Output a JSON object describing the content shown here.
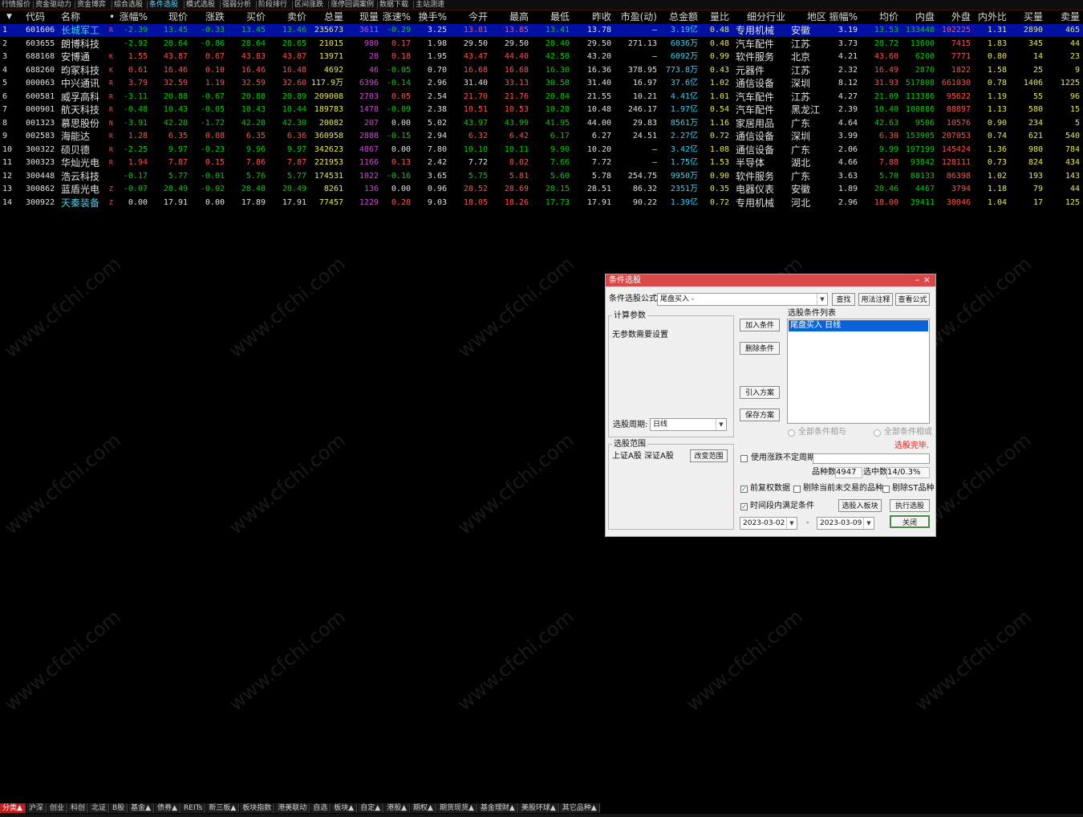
{
  "top_tabs": [
    "行情报价",
    "资金驱动力",
    "资金博弈",
    "综合选股",
    "条件选股",
    "模式选股",
    "强弱分析",
    "阶段排行",
    "区间涨跌",
    "涨停回调案例",
    "数据下载",
    "主站测速"
  ],
  "active_top_tab": "条件选股",
  "columns": [
    "",
    "代码",
    "名称",
    "•",
    "涨幅%",
    "现价",
    "涨跌",
    "买价",
    "卖价",
    "总量",
    "现量",
    "涨速%",
    "换手%",
    "今开",
    "最高",
    "最低",
    "昨收",
    "市盈(动)",
    "总金额",
    "量比",
    "细分行业",
    "地区",
    "振幅%",
    "均价",
    "内盘",
    "外盘",
    "内外比",
    "买量",
    "卖量"
  ],
  "rows": [
    {
      "i": "1",
      "code": "601606",
      "name": "长城军工",
      "flag": "R",
      "chg": "-2.39",
      "price": "13.45",
      "diff": "-0.33",
      "bid": "13.45",
      "ask": "13.46",
      "vol": "235673",
      "cur": "3611",
      "speed": "-0.29",
      "turn": "3.25",
      "open": "13.81",
      "high": "13.85",
      "low": "13.41",
      "prev": "13.78",
      "pe": "–",
      "amt": "3.19亿",
      "vr": "0.48",
      "ind": "专用机械",
      "reg": "安徽",
      "amp": "3.19",
      "avg": "13.53",
      "inner": "133448",
      "outer": "102225",
      "io": "1.31",
      "bv": "2890",
      "sv": "465"
    },
    {
      "i": "2",
      "code": "603655",
      "name": "朗博科技",
      "flag": "",
      "chg": "-2.92",
      "price": "28.64",
      "diff": "-0.86",
      "bid": "28.64",
      "ask": "28.65",
      "vol": "21015",
      "cur": "980",
      "speed": "0.17",
      "turn": "1.98",
      "open": "29.50",
      "high": "29.50",
      "low": "28.40",
      "prev": "29.50",
      "pe": "271.13",
      "amt": "6036万",
      "vr": "0.48",
      "ind": "汽车配件",
      "reg": "江苏",
      "amp": "3.73",
      "avg": "28.72",
      "inner": "13600",
      "outer": "7415",
      "io": "1.83",
      "bv": "345",
      "sv": "44"
    },
    {
      "i": "3",
      "code": "688168",
      "name": "安博通",
      "flag": "K",
      "chg": "1.55",
      "price": "43.87",
      "diff": "0.67",
      "bid": "43.83",
      "ask": "43.87",
      "vol": "13971",
      "cur": "28",
      "speed": "0.18",
      "turn": "1.95",
      "open": "43.47",
      "high": "44.40",
      "low": "42.58",
      "prev": "43.20",
      "pe": "–",
      "amt": "6092万",
      "vr": "0.99",
      "ind": "软件服务",
      "reg": "北京",
      "amp": "4.21",
      "avg": "43.60",
      "inner": "6200",
      "outer": "7771",
      "io": "0.80",
      "bv": "14",
      "sv": "23"
    },
    {
      "i": "4",
      "code": "688260",
      "name": "昀冢科技",
      "flag": "K",
      "chg": "0.61",
      "price": "16.46",
      "diff": "0.10",
      "bid": "16.46",
      "ask": "16.48",
      "vol": "4692",
      "cur": "46",
      "speed": "-0.05",
      "turn": "0.70",
      "open": "16.68",
      "high": "16.68",
      "low": "16.30",
      "prev": "16.36",
      "pe": "378.95",
      "amt": "773.8万",
      "vr": "0.43",
      "ind": "元器件",
      "reg": "江苏",
      "amp": "2.32",
      "avg": "16.49",
      "inner": "2870",
      "outer": "1822",
      "io": "1.58",
      "bv": "25",
      "sv": "9"
    },
    {
      "i": "5",
      "code": "000063",
      "name": "中兴通讯",
      "flag": "R",
      "chg": "3.79",
      "price": "32.59",
      "diff": "1.19",
      "bid": "32.59",
      "ask": "32.60",
      "vol": "117.9万",
      "cur": "6396",
      "speed": "-0.14",
      "turn": "2.96",
      "open": "31.40",
      "high": "33.13",
      "low": "30.58",
      "prev": "31.40",
      "pe": "16.97",
      "amt": "37.6亿",
      "vr": "1.02",
      "ind": "通信设备",
      "reg": "深圳",
      "amp": "8.12",
      "avg": "31.93",
      "inner": "517808",
      "outer": "661030",
      "io": "0.78",
      "bv": "1406",
      "sv": "1225"
    },
    {
      "i": "6",
      "code": "600581",
      "name": "威孚高科",
      "flag": "R",
      "chg": "-3.11",
      "price": "20.88",
      "diff": "-0.67",
      "bid": "20.88",
      "ask": "20.89",
      "vol": "209008",
      "cur": "2703",
      "speed": "0.05",
      "turn": "2.54",
      "open": "21.70",
      "high": "21.76",
      "low": "20.84",
      "prev": "21.55",
      "pe": "10.21",
      "amt": "4.41亿",
      "vr": "1.01",
      "ind": "汽车配件",
      "reg": "江苏",
      "amp": "4.27",
      "avg": "21.09",
      "inner": "113386",
      "outer": "95622",
      "io": "1.19",
      "bv": "55",
      "sv": "96"
    },
    {
      "i": "7",
      "code": "000901",
      "name": "航天科技",
      "flag": "R",
      "chg": "-0.48",
      "price": "10.43",
      "diff": "-0.05",
      "bid": "10.43",
      "ask": "10.44",
      "vol": "189783",
      "cur": "1478",
      "speed": "-0.09",
      "turn": "2.38",
      "open": "10.51",
      "high": "10.53",
      "low": "10.28",
      "prev": "10.48",
      "pe": "246.17",
      "amt": "1.97亿",
      "vr": "0.54",
      "ind": "汽车配件",
      "reg": "黑龙江",
      "amp": "2.39",
      "avg": "10.40",
      "inner": "100886",
      "outer": "88897",
      "io": "1.13",
      "bv": "580",
      "sv": "15"
    },
    {
      "i": "8",
      "code": "001323",
      "name": "慕思股份",
      "flag": "N",
      "chg": "-3.91",
      "price": "42.28",
      "diff": "-1.72",
      "bid": "42.28",
      "ask": "42.30",
      "vol": "20082",
      "cur": "207",
      "speed": "0.00",
      "turn": "5.02",
      "open": "43.97",
      "high": "43.99",
      "low": "41.95",
      "prev": "44.00",
      "pe": "29.83",
      "amt": "8561万",
      "vr": "1.16",
      "ind": "家居用品",
      "reg": "广东",
      "amp": "4.64",
      "avg": "42.63",
      "inner": "9506",
      "outer": "10576",
      "io": "0.90",
      "bv": "234",
      "sv": "5"
    },
    {
      "i": "9",
      "code": "002583",
      "name": "海能达",
      "flag": "R",
      "chg": "1.28",
      "price": "6.35",
      "diff": "0.08",
      "bid": "6.35",
      "ask": "6.36",
      "vol": "360958",
      "cur": "2888",
      "speed": "-0.15",
      "turn": "2.94",
      "open": "6.32",
      "high": "6.42",
      "low": "6.17",
      "prev": "6.27",
      "pe": "24.51",
      "amt": "2.27亿",
      "vr": "0.72",
      "ind": "通信设备",
      "reg": "深圳",
      "amp": "3.99",
      "avg": "6.30",
      "inner": "153905",
      "outer": "207053",
      "io": "0.74",
      "bv": "621",
      "sv": "540"
    },
    {
      "i": "10",
      "code": "300322",
      "name": "硕贝德",
      "flag": "R",
      "chg": "-2.25",
      "price": "9.97",
      "diff": "-0.23",
      "bid": "9.96",
      "ask": "9.97",
      "vol": "342623",
      "cur": "4867",
      "speed": "0.00",
      "turn": "7.80",
      "open": "10.10",
      "high": "10.11",
      "low": "9.90",
      "prev": "10.20",
      "pe": "–",
      "amt": "3.42亿",
      "vr": "1.08",
      "ind": "通信设备",
      "reg": "广东",
      "amp": "2.06",
      "avg": "9.99",
      "inner": "197199",
      "outer": "145424",
      "io": "1.36",
      "bv": "980",
      "sv": "784"
    },
    {
      "i": "11",
      "code": "300323",
      "name": "华灿光电",
      "flag": "R",
      "chg": "1.94",
      "price": "7.87",
      "diff": "0.15",
      "bid": "7.86",
      "ask": "7.87",
      "vol": "221953",
      "cur": "1166",
      "speed": "0.13",
      "turn": "2.42",
      "open": "7.72",
      "high": "8.02",
      "low": "7.66",
      "prev": "7.72",
      "pe": "–",
      "amt": "1.75亿",
      "vr": "1.53",
      "ind": "半导体",
      "reg": "湖北",
      "amp": "4.66",
      "avg": "7.88",
      "inner": "93842",
      "outer": "128111",
      "io": "0.73",
      "bv": "824",
      "sv": "434"
    },
    {
      "i": "12",
      "code": "300448",
      "name": "浩云科技",
      "flag": "",
      "chg": "-0.17",
      "price": "5.77",
      "diff": "-0.01",
      "bid": "5.76",
      "ask": "5.77",
      "vol": "174531",
      "cur": "1022",
      "speed": "-0.16",
      "turn": "3.65",
      "open": "5.75",
      "high": "5.81",
      "low": "5.60",
      "prev": "5.78",
      "pe": "254.75",
      "amt": "9950万",
      "vr": "0.90",
      "ind": "软件服务",
      "reg": "广东",
      "amp": "3.63",
      "avg": "5.70",
      "inner": "88133",
      "outer": "86398",
      "io": "1.02",
      "bv": "193",
      "sv": "143"
    },
    {
      "i": "13",
      "code": "300862",
      "name": "蓝盾光电",
      "flag": "Z",
      "chg": "-0.07",
      "price": "28.49",
      "diff": "-0.02",
      "bid": "28.48",
      "ask": "28.49",
      "vol": "8261",
      "cur": "136",
      "speed": "0.00",
      "turn": "0.96",
      "open": "28.52",
      "high": "28.69",
      "low": "28.15",
      "prev": "28.51",
      "pe": "86.32",
      "amt": "2351万",
      "vr": "0.35",
      "ind": "电器仪表",
      "reg": "安徽",
      "amp": "1.89",
      "avg": "28.46",
      "inner": "4467",
      "outer": "3794",
      "io": "1.18",
      "bv": "79",
      "sv": "44"
    },
    {
      "i": "14",
      "code": "300922",
      "name": "天秦装备",
      "flag": "Z",
      "chg": "0.00",
      "price": "17.91",
      "diff": "0.00",
      "bid": "17.89",
      "ask": "17.91",
      "vol": "77457",
      "cur": "1229",
      "speed": "0.28",
      "turn": "9.03",
      "open": "18.05",
      "high": "18.26",
      "low": "17.73",
      "prev": "17.91",
      "pe": "90.22",
      "amt": "1.39亿",
      "vr": "0.72",
      "ind": "专用机械",
      "reg": "河北",
      "amp": "2.96",
      "avg": "18.00",
      "inner": "39411",
      "outer": "38046",
      "io": "1.04",
      "bv": "17",
      "sv": "125"
    }
  ],
  "watermark": "www.cfchi.com",
  "dialog": {
    "title": "条件选股",
    "formula_label": "条件选股公式",
    "formula_value": "尾盘买入  -",
    "find_btn": "查找",
    "usage_btn": "用法注释",
    "view_btn": "查看公式",
    "params_title": "计算参数",
    "params_text": "无参数需要设置",
    "add_btn": "加入条件",
    "del_btn": "删除条件",
    "import_btn": "引入方案",
    "save_btn": "保存方案",
    "list_title": "选股条件列表",
    "list_item": "尾盘买入  日线",
    "period_label": "选股周期:",
    "period_value": "日线",
    "and_label": "全部条件相与",
    "or_label": "全部条件相或",
    "status": "选股完毕.",
    "range_title": "选股范围",
    "range_text": "上证A股 深证A股",
    "range_btn": "改变范围",
    "use_period_label": "使用涨跌不定周期",
    "count_label": "品种数",
    "count_value": "4947",
    "selected_label": "选中数",
    "selected_value": "14/0.3%",
    "fq_label": "前复权数据",
    "excl_untraded_label": "剔除当前未交易的品种",
    "excl_st_label": "剔除ST品种",
    "time_range_label": "时间段内满足条件",
    "to_board_btn": "选股入板块",
    "run_btn": "执行选股",
    "date_from": "2023-03-02",
    "date_to": "2023-03-09",
    "close_btn": "关闭"
  },
  "bottom_tabs": [
    "分类▲",
    "沪深",
    "创业",
    "科创",
    "北证",
    "B股",
    "基金▲",
    "债券▲",
    "REITs",
    "新三板▲",
    "板块指数",
    "港美联动",
    "自选",
    "板块▲",
    "自定▲",
    "港股▲",
    "期权▲",
    "期货现货▲",
    "基金理财▲",
    "美股环球▲",
    "其它品种▲"
  ],
  "colors": {
    "up": "#ff5050",
    "down": "#00d000",
    "selected_row": "#0010a0",
    "dialog_title": "#d84848",
    "list_highlight": "#0a64d8"
  }
}
